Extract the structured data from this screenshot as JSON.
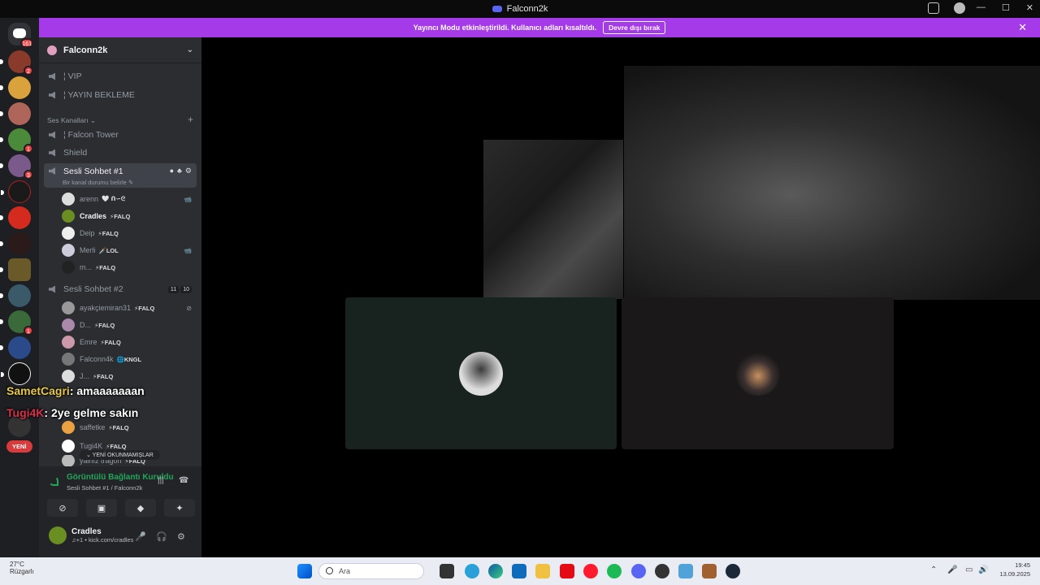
{
  "window": {
    "title": "Falconn2k",
    "controls": [
      "—",
      "☐",
      "✕"
    ]
  },
  "guilds": {
    "home_badge": "161",
    "badges": [
      "2",
      "1",
      "3",
      "1"
    ]
  },
  "banner": {
    "text": "Yayıncı Modu etkinleştirildi. Kullanıcı adları kısaltıldı.",
    "button": "Devre dışı bırak",
    "close": "✕"
  },
  "server": {
    "name": "Falconn2k",
    "text_channels": [
      "¦ VIP",
      "¦ YAYIN BEKLEME"
    ],
    "voice_category": "Ses Kanalları",
    "voice_channels": [
      {
        "name": "¦ Falcon Tower"
      },
      {
        "name": "Shield"
      },
      {
        "name": "Sesli Sohbet #1",
        "status": "Bir kanal durumu belirle"
      },
      {
        "name": "Sesli Sohbet #2",
        "counts": [
          "11",
          "10"
        ]
      }
    ],
    "members_1": [
      {
        "name": "arenn",
        "tag": "🤍 ᑎ∽ᘓ",
        "right": "📹"
      },
      {
        "name": "Cradles",
        "tag": "⚡FALQ",
        "right": ""
      },
      {
        "name": "Deip",
        "tag": "⚡FALQ",
        "right": ""
      },
      {
        "name": "Merli",
        "tag": "🗡️LOL",
        "right": "📹"
      },
      {
        "name": "m...",
        "tag": "⚡FALQ",
        "right": ""
      }
    ],
    "members_2": [
      {
        "name": "ayakçiemiran31",
        "tag": "⚡FALQ"
      },
      {
        "name": "D...",
        "tag": "⚡FALQ"
      },
      {
        "name": "Emre",
        "tag": "⚡FALQ"
      },
      {
        "name": "Falconn4k",
        "tag": "🌐KNGL"
      },
      {
        "name": "J...",
        "tag": "⚡FALQ"
      },
      {
        "name": "saffetke",
        "tag": "⚡FALQ"
      },
      {
        "name": "Tugi4K",
        "tag": "⚡FALQ"
      },
      {
        "name": "yalnız tragon",
        "tag": "⚡FALQ"
      }
    ],
    "unread_pill": "⌄ YENİ OKUNMAMIŞLAR"
  },
  "voice_panel": {
    "title": "Görüntülü Bağlantı Kuruldu",
    "subtitle": "Sesli Sohbet #1 / Falconn2k",
    "user_name": "Cradles",
    "user_status": "♫+1 • kick.com/cradles"
  },
  "chat_overlay": [
    {
      "name": "SametCagri",
      "message": ": amaaaaaaan"
    },
    {
      "name": "Tugi4K",
      "message": ": 2ye gelme sakın"
    }
  ],
  "yeni_badge": "YENİ",
  "taskbar": {
    "temperature": "27°C",
    "weather": "Rüzgarlı",
    "search_placeholder": "Ara",
    "time": "19:45",
    "date": "13.09.2025"
  }
}
